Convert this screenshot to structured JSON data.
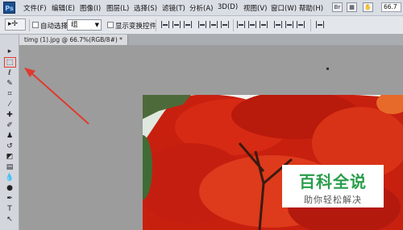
{
  "app": {
    "logo_text": "Ps",
    "zoom": "66.7"
  },
  "menu": [
    "文件(F)",
    "编辑(E)",
    "图像(I)",
    "图层(L)",
    "选择(S)",
    "滤镜(T)",
    "分析(A)",
    "3D(D)",
    "视图(V)",
    "窗口(W)",
    "帮助(H)"
  ],
  "options": {
    "tool_glyph": "▸✢",
    "auto_select_label": "自动选择:",
    "auto_select_value": "组",
    "show_transform_label": "显示变换控件"
  },
  "document": {
    "tab_label": "timg (1).jpg @ 66.7%(RGB/8#) *"
  },
  "watermark": {
    "title": "百科全说",
    "subtitle": "助你轻松解决"
  },
  "colors": {
    "arrow": "#e03a2e",
    "highlight": "#e03a2e"
  }
}
